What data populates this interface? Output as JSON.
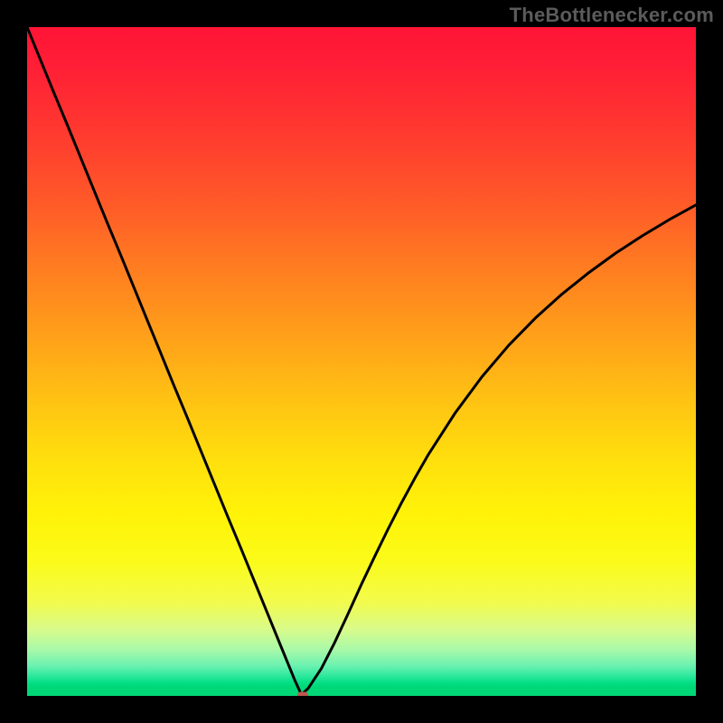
{
  "watermark": "TheBottlenecker.com",
  "chart_data": {
    "type": "line",
    "title": "",
    "xlabel": "",
    "ylabel": "",
    "xlim": [
      0,
      100
    ],
    "ylim": [
      0,
      100
    ],
    "x": [
      0,
      2,
      4,
      6,
      8,
      10,
      12,
      14,
      16,
      18,
      20,
      22,
      24,
      26,
      28,
      30,
      32,
      34,
      36,
      38,
      40,
      41,
      42,
      44,
      46,
      48,
      50,
      52,
      54,
      56,
      58,
      60,
      64,
      68,
      72,
      76,
      80,
      84,
      88,
      92,
      96,
      100
    ],
    "values": [
      100,
      95.1,
      90.2,
      85.4,
      80.5,
      75.6,
      70.7,
      65.9,
      61.0,
      56.1,
      51.2,
      46.3,
      41.5,
      36.6,
      31.7,
      26.8,
      22.0,
      17.1,
      12.2,
      7.3,
      2.4,
      0.2,
      1.1,
      4.1,
      8.0,
      12.3,
      16.7,
      20.9,
      25.0,
      28.9,
      32.6,
      36.1,
      42.3,
      47.7,
      52.4,
      56.5,
      60.1,
      63.3,
      66.2,
      68.8,
      71.2,
      73.4
    ],
    "curve_min_x": 40.5,
    "marker": {
      "x": 41.2,
      "y": 0.0
    },
    "background_gradient": {
      "top": "#ff1436",
      "mid": "#ffe00d",
      "bottom": "#00d878"
    },
    "grid": false,
    "legend": false
  }
}
